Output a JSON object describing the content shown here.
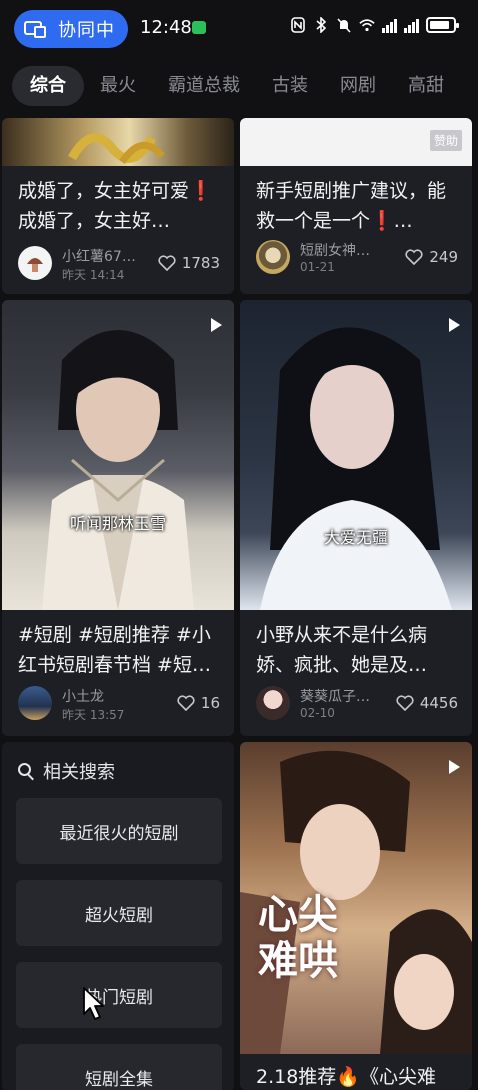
{
  "status_bar": {
    "collab_label": "协同中",
    "time": "12:48"
  },
  "tabs": [
    "综合",
    "最火",
    "霸道总裁",
    "古装",
    "网剧",
    "高甜"
  ],
  "feed": {
    "card1": {
      "title": "成婚了，女主好可爱❗成婚了，女主好…",
      "author": "小红薯67…",
      "date": "昨天 14:14",
      "likes": "1783"
    },
    "card2": {
      "badge": "赞助",
      "title": "新手短剧推广建议，能救一个是一个❗…",
      "author": "短剧女神…",
      "date": "01-21",
      "likes": "249"
    },
    "card3": {
      "subtitle": "听闻那林玉雪",
      "title": "#短剧 #短剧推荐 #小红书短剧春节档 #短…",
      "author": "小土龙",
      "date": "昨天 13:57",
      "likes": "16"
    },
    "card4": {
      "subtitle": "大爱无疆",
      "title": "小野从来不是什么病娇、疯批、她是及…",
      "author": "葵葵瓜子…",
      "date": "02-10",
      "likes": "4456"
    },
    "card5": {
      "poster_text": "心尖难哄",
      "title": "2.18推荐🔥《心尖难"
    }
  },
  "related_search": {
    "heading": "相关搜索",
    "items": [
      "最近很火的短剧",
      "超火短剧",
      "热门短剧",
      "短剧全集"
    ]
  }
}
